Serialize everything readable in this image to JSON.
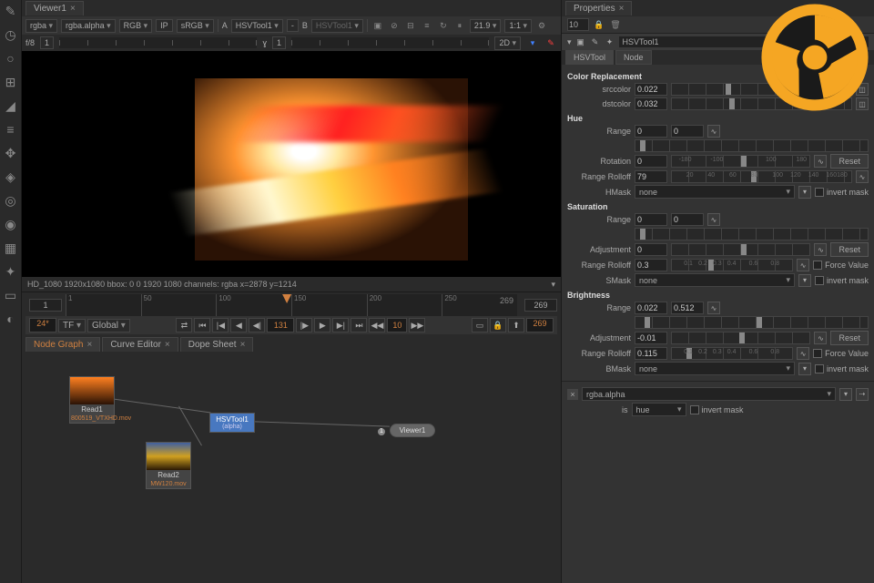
{
  "viewer": {
    "tab_label": "Viewer1",
    "channel": "rgba",
    "alpha": "rgba.alpha",
    "colorspace": "RGB",
    "lut": "sRGB",
    "input_a_label": "A",
    "input_a": "HSVTool1",
    "input_b_label": "B",
    "input_b": "HSVTool1",
    "zoom": "21.9",
    "ratio": "1:1",
    "view_mode": "2D",
    "fstop_label": "f/8",
    "fstop_val": "1",
    "gamma_label": "ɣ",
    "gamma_val": "1",
    "info": "HD_1080 1920x1080  bbox: 0 0 1920 1080 channels: rgba   x=2878 y=1214"
  },
  "timeline": {
    "start": "1",
    "end": "269",
    "ranges": [
      "1",
      "50",
      "100",
      "150",
      "200",
      "250"
    ],
    "fps": "24*",
    "tf": "TF",
    "global": "Global",
    "current": "131",
    "skip": "10",
    "end_frame": "269"
  },
  "nodegraph": {
    "tabs": [
      "Node Graph",
      "Curve Editor",
      "Dope Sheet"
    ],
    "read1": {
      "name": "Read1",
      "file": "800519_VTXHD.mov"
    },
    "read2": {
      "name": "Read2",
      "file": "MW120.mov"
    },
    "hsv": {
      "name": "HSVTool1",
      "sub": "(alpha)"
    },
    "viewer": {
      "name": "Viewer1",
      "input": "1"
    }
  },
  "props": {
    "tab_label": "Properties",
    "count": "10",
    "node_name": "HSVTool1",
    "tabs": [
      "HSVTool",
      "Node"
    ],
    "sections": {
      "color_replacement": "Color Replacement",
      "hue": "Hue",
      "saturation": "Saturation",
      "brightness": "Brightness"
    },
    "labels": {
      "srccolor": "srccolor",
      "dstcolor": "dstcolor",
      "range": "Range",
      "rotation": "Rotation",
      "range_rolloff": "Range Rolloff",
      "hmask": "HMask",
      "smask": "SMask",
      "bmask": "BMask",
      "adjustment": "Adjustment",
      "is": "is",
      "none": "none",
      "hue": "hue",
      "invert_mask": "invert mask",
      "force_value": "Force Value",
      "reset": "Reset"
    },
    "values": {
      "srccolor": "0.022",
      "dstcolor": "0.032",
      "hue_range_a": "0",
      "hue_range_b": "0",
      "rotation": "0",
      "hue_rolloff": "79",
      "sat_range_a": "0",
      "sat_range_b": "0",
      "sat_adjust": "0",
      "sat_rolloff": "0.3",
      "bri_range_a": "0.022",
      "bri_range_b": "0.512",
      "bri_adjust": "-0.01",
      "bri_rolloff": "0.115"
    },
    "footer_channel": "rgba.alpha",
    "rotation_ticks": [
      "-180",
      "-100",
      "100",
      "180"
    ],
    "rolloff_ticks": [
      "20",
      "40",
      "60",
      "80",
      "100",
      "120",
      "140",
      "160180"
    ],
    "rolloff_sat_ticks": [
      "0.1",
      "0.2",
      "0.3",
      "0.4",
      "0.6",
      "0.8"
    ],
    "rolloff_bri_ticks": [
      "0.1",
      "0.2",
      "0.3",
      "0.4",
      "0.6",
      "0.8"
    ]
  }
}
